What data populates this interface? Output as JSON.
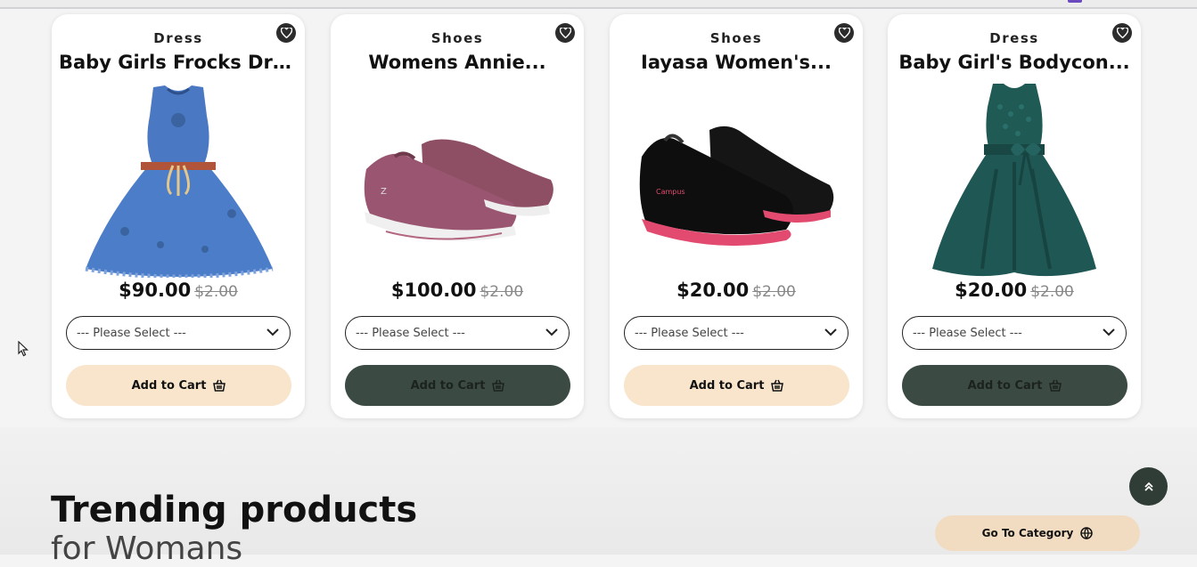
{
  "products": [
    {
      "category": "Dress",
      "title": "Baby Girls Frocks Dress",
      "price": "$90.00",
      "old_price": "$2.00",
      "select_placeholder": "--- Please Select ---",
      "cart_label": "Add to Cart",
      "cart_style": "light",
      "image": "denim-dress-image"
    },
    {
      "category": "Shoes",
      "title": "Womens Annie...",
      "price": "$100.00",
      "old_price": "$2.00",
      "select_placeholder": "--- Please Select ---",
      "cart_label": "Add to Cart",
      "cart_style": "dark",
      "image": "mauve-sneakers-image"
    },
    {
      "category": "Shoes",
      "title": "Iayasa Women's...",
      "price": "$20.00",
      "old_price": "$2.00",
      "select_placeholder": "--- Please Select ---",
      "cart_label": "Add to Cart",
      "cart_style": "light",
      "image": "black-sneakers-image"
    },
    {
      "category": "Dress",
      "title": "Baby Girl's Bodycon...",
      "price": "$20.00",
      "old_price": "$2.00",
      "select_placeholder": "--- Please Select ---",
      "cart_label": "Add to Cart",
      "cart_style": "dark",
      "image": "teal-dress-image"
    }
  ],
  "section": {
    "title": "Trending products",
    "subtitle": "for Womans"
  },
  "goto_category": {
    "label": "Go To Category",
    "icon": "globe-icon"
  },
  "scroll_top": {
    "icon": "double-chevron-up-icon"
  },
  "colors": {
    "accent_light": "#f8e5cc",
    "accent_dark": "#3b4a42",
    "background": "#f4f4f4"
  }
}
